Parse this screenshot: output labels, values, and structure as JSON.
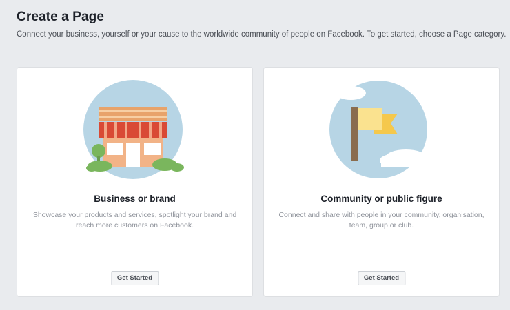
{
  "header": {
    "title": "Create a Page",
    "subtitle": "Connect your business, yourself or your cause to the worldwide community of people on Facebook. To get started, choose a Page category."
  },
  "cards": [
    {
      "icon": "storefront-icon",
      "title": "Business or brand",
      "description": "Showcase your products and services, spotlight your brand and reach more customers on Facebook.",
      "button_label": "Get Started"
    },
    {
      "icon": "flag-icon",
      "title": "Community or public figure",
      "description": "Connect and share with people in your community, organisation, team, group or club.",
      "button_label": "Get Started"
    }
  ],
  "colors": {
    "background": "#e9ebee",
    "illustration_circle": "#b7d5e5",
    "awning_red": "#d94a35",
    "flag_yellow": "#f5c84c"
  }
}
